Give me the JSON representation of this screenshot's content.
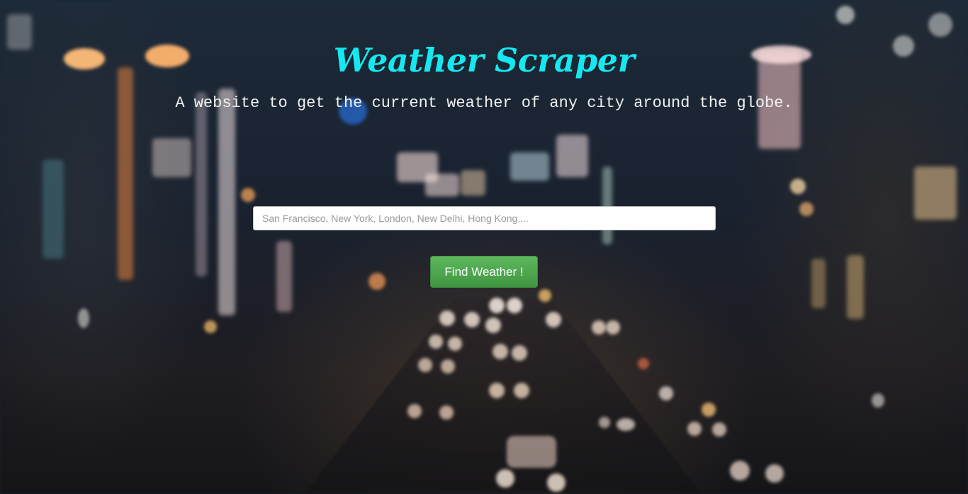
{
  "header": {
    "title": "Weather Scraper",
    "subtitle": "A website to get the current weather of any city around the globe."
  },
  "search": {
    "value": "",
    "placeholder": "San Francisco, New York, London, New Delhi, Hong Kong...."
  },
  "actions": {
    "find_label": "Find Weather !"
  },
  "colors": {
    "title": "#15e8f0",
    "subtitle": "#f2f2f2",
    "button": "#4cae4c",
    "background": "#1b2532"
  }
}
